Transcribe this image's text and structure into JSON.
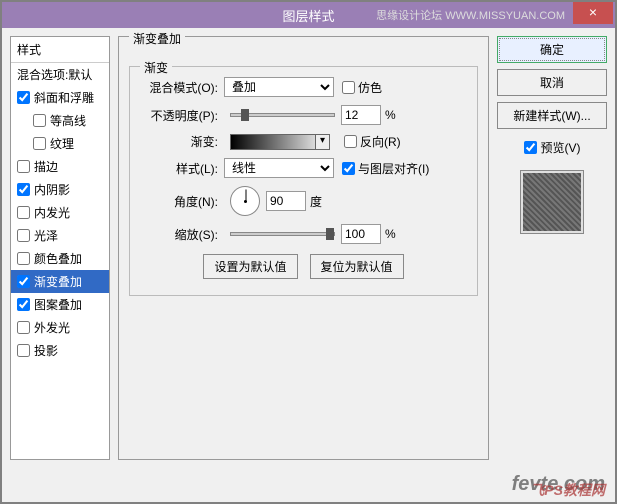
{
  "titlebar": {
    "title": "图层样式",
    "branding": "思缘设计论坛 WWW.MISSYUAN.COM",
    "close": "×"
  },
  "left": {
    "header": "样式",
    "blend_default": "混合选项:默认",
    "items": [
      {
        "label": "斜面和浮雕",
        "checked": true,
        "indent": false
      },
      {
        "label": "等高线",
        "checked": false,
        "indent": true
      },
      {
        "label": "纹理",
        "checked": false,
        "indent": true
      },
      {
        "label": "描边",
        "checked": false,
        "indent": false
      },
      {
        "label": "内阴影",
        "checked": true,
        "indent": false
      },
      {
        "label": "内发光",
        "checked": false,
        "indent": false
      },
      {
        "label": "光泽",
        "checked": false,
        "indent": false
      },
      {
        "label": "颜色叠加",
        "checked": false,
        "indent": false
      },
      {
        "label": "渐变叠加",
        "checked": true,
        "indent": false,
        "selected": true
      },
      {
        "label": "图案叠加",
        "checked": true,
        "indent": false
      },
      {
        "label": "外发光",
        "checked": false,
        "indent": false
      },
      {
        "label": "投影",
        "checked": false,
        "indent": false
      }
    ]
  },
  "middle": {
    "section_title": "渐变叠加",
    "fieldset_title": "渐变",
    "blend_mode_label": "混合模式(O):",
    "blend_mode_value": "叠加",
    "dither_label": "仿色",
    "opacity_label": "不透明度(P):",
    "opacity_value": "12",
    "percent": "%",
    "gradient_label": "渐变:",
    "reverse_label": "反向(R)",
    "style_label": "样式(L):",
    "style_value": "线性",
    "align_label": "与图层对齐(I)",
    "angle_label": "角度(N):",
    "angle_value": "90",
    "degree": "度",
    "scale_label": "缩放(S):",
    "scale_value": "100",
    "set_default": "设置为默认值",
    "reset_default": "复位为默认值"
  },
  "right": {
    "ok": "确定",
    "cancel": "取消",
    "new_style": "新建样式(W)...",
    "preview": "预览(V)"
  },
  "watermark": {
    "main": "fevte.com",
    "sub": "飞PS教程网"
  }
}
